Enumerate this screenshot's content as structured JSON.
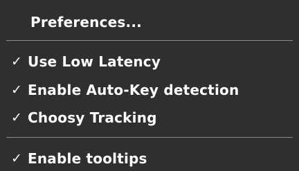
{
  "menu": {
    "colors": {
      "background": "#2f2f2f",
      "text": "#ffffff",
      "separator": "#8e8e8e"
    },
    "check_glyph": "✓",
    "items": [
      {
        "label": "Preferences...",
        "checked": false
      },
      {
        "label": "Use Low Latency",
        "checked": true
      },
      {
        "label": "Enable Auto-Key detection",
        "checked": true
      },
      {
        "label": "Choosy Tracking",
        "checked": true
      },
      {
        "label": "Enable tooltips",
        "checked": true
      }
    ]
  }
}
